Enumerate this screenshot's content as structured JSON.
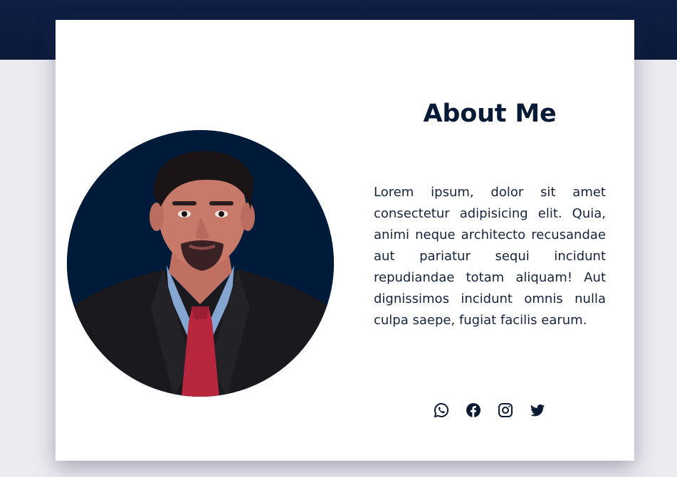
{
  "about": {
    "title": "About Me",
    "bio": "Lorem ipsum, dolor sit amet consectetur adipisicing elit. Quia, animi neque architecto recusandae aut pariatur sequi incidunt repudiandae totam aliquam! Aut dignissimos incidunt omnis nulla culpa saepe, fugiat facilis earum."
  },
  "social": [
    {
      "name": "whatsapp",
      "icon": "whatsapp-icon"
    },
    {
      "name": "facebook",
      "icon": "facebook-icon"
    },
    {
      "name": "instagram",
      "icon": "instagram-icon"
    },
    {
      "name": "twitter",
      "icon": "twitter-icon"
    }
  ],
  "colors": {
    "header_band": "#0f1f44",
    "card_bg": "#ffffff",
    "title": "#071a36",
    "text": "#15233a",
    "photo_bg": "#001a3a"
  }
}
